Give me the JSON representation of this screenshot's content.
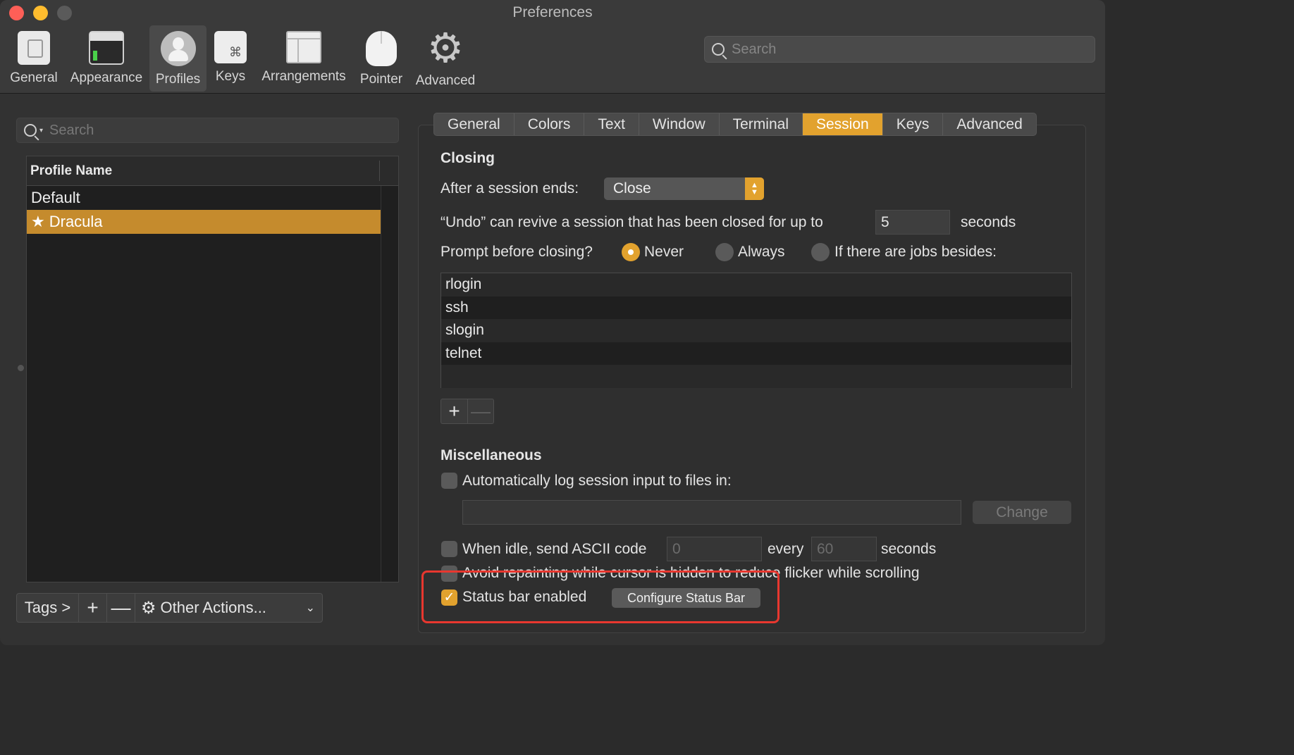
{
  "window": {
    "title": "Preferences"
  },
  "toolbar": {
    "items": [
      {
        "label": "General",
        "icon": "general-icon"
      },
      {
        "label": "Appearance",
        "icon": "appearance-icon"
      },
      {
        "label": "Profiles",
        "icon": "profiles-icon"
      },
      {
        "label": "Keys",
        "icon": "keys-icon"
      },
      {
        "label": "Arrangements",
        "icon": "arrangements-icon"
      },
      {
        "label": "Pointer",
        "icon": "pointer-icon"
      },
      {
        "label": "Advanced",
        "icon": "gear-icon"
      }
    ],
    "selected": "Profiles",
    "keys_glyph": "⌘",
    "gear_glyph": "⚙",
    "search_placeholder": "Search"
  },
  "profiles": {
    "search_placeholder": "Search",
    "header": "Profile Name",
    "rows": [
      {
        "name": "Default"
      },
      {
        "name": "Dracula",
        "star": "★"
      }
    ],
    "selected": "Dracula",
    "bottom": {
      "tags": "Tags >",
      "plus": "+",
      "minus": "—",
      "other_actions": "Other Actions...",
      "chevron": "⌄"
    }
  },
  "tabs": [
    {
      "label": "General"
    },
    {
      "label": "Colors"
    },
    {
      "label": "Text"
    },
    {
      "label": "Window"
    },
    {
      "label": "Terminal"
    },
    {
      "label": "Session"
    },
    {
      "label": "Keys"
    },
    {
      "label": "Advanced"
    }
  ],
  "active_tab": "Session",
  "closing": {
    "title": "Closing",
    "after_label": "After a session ends:",
    "after_value": "Close",
    "undo_label": "“Undo” can revive a session that has been closed for up to",
    "undo_value": "5",
    "undo_unit": "seconds",
    "prompt_label": "Prompt before closing?",
    "options": [
      {
        "label": "Never",
        "selected": true
      },
      {
        "label": "Always",
        "selected": false
      },
      {
        "label": "If there are jobs besides:",
        "selected": false
      }
    ],
    "jobs": [
      "rlogin",
      "ssh",
      "slogin",
      "telnet"
    ],
    "add": "+",
    "remove": "—"
  },
  "misc": {
    "title": "Miscellaneous",
    "log_label": "Automatically log session input to files in:",
    "log_checked": false,
    "change_button": "Change",
    "idle_label": "When idle, send ASCII code",
    "idle_code": "0",
    "idle_every": "every",
    "idle_seconds_value": "60",
    "idle_unit": "seconds",
    "idle_checked": false,
    "avoid_label": "Avoid repainting while cursor is hidden to reduce flicker while scrolling",
    "avoid_checked": false,
    "status_bar_label": "Status bar enabled",
    "status_bar_checked": true,
    "configure_button": "Configure Status Bar",
    "check_glyph": "✓"
  },
  "colors": {
    "accent": "#e2a22e",
    "selection": "#c58b2d",
    "highlight": "#e8372f"
  }
}
